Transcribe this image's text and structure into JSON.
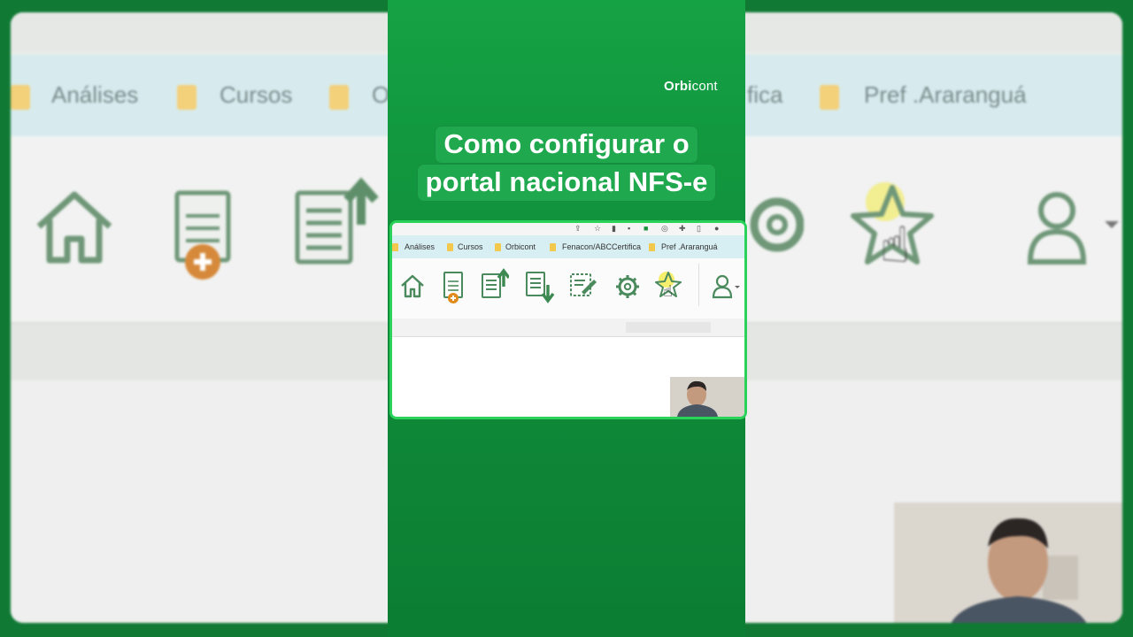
{
  "brand": {
    "prefix": "Orbi",
    "suffix": "cont"
  },
  "title": {
    "line1": "Como configurar o",
    "line2": "portal nacional NFS-e"
  },
  "browser": {
    "bookmarks": [
      "Análises",
      "Cursos",
      "Orbicont",
      "Fenacon/ABCCertifica",
      "Pref .Araranguá"
    ]
  },
  "background": {
    "bookmarks": [
      "Análises",
      "Cursos",
      "O",
      "fica",
      "Pref .Araranguá"
    ]
  },
  "toolbar_icons": [
    "home-icon",
    "nfse-add-icon",
    "document-upload-icon",
    "document-download-icon",
    "document-edit-icon",
    "gear-icon",
    "star-favorite-icon",
    "user-icon"
  ],
  "colors": {
    "brand_green": "#13a043",
    "highlight_border": "#2ad25a",
    "icon_green": "#4a8a5c",
    "add_orange": "#e08a1e"
  },
  "icon_glyphs": {
    "cursor": "☝"
  }
}
